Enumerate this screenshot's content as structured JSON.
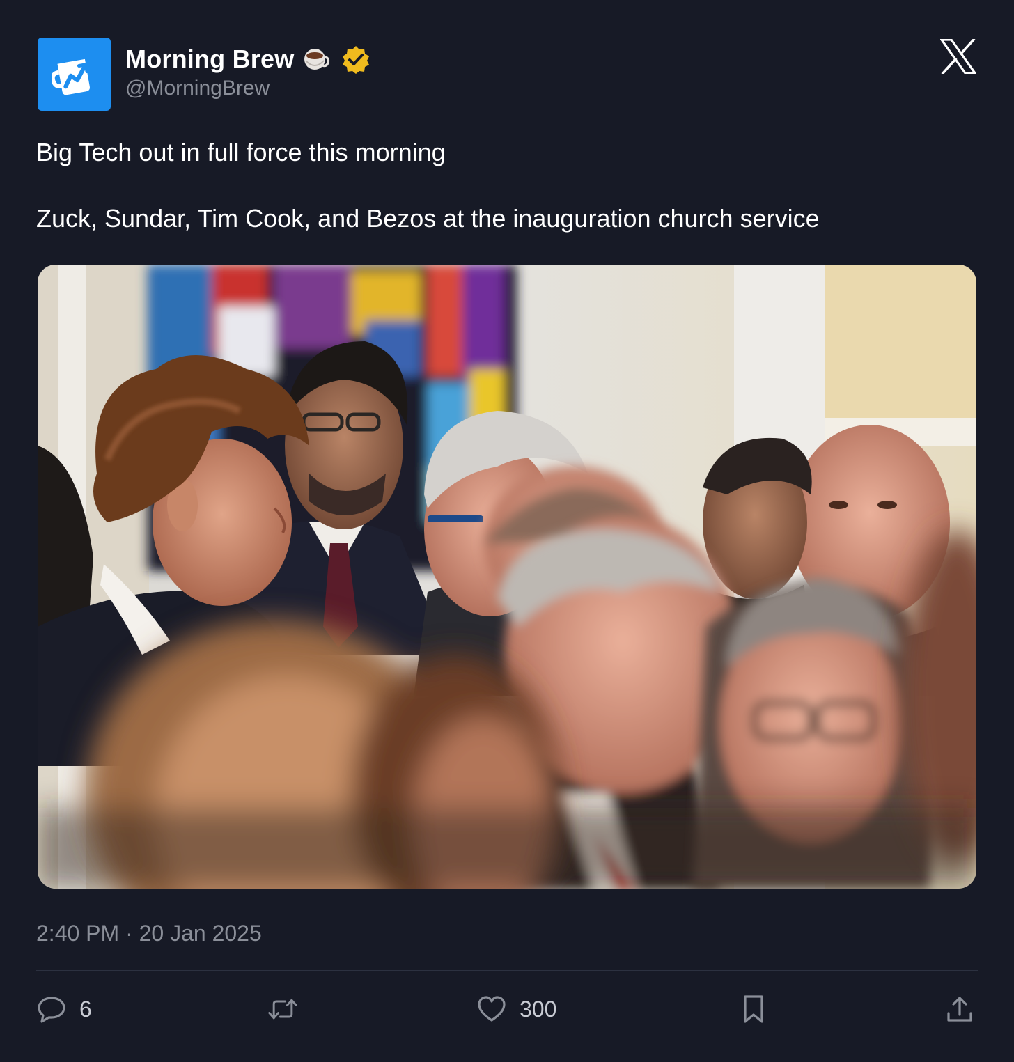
{
  "author": {
    "display_name": "Morning Brew",
    "handle": "@MorningBrew",
    "emoji": "coffee-cup",
    "verified": true,
    "avatar_color": "#1d8ef0",
    "badge_color": "#f0bb1e"
  },
  "platform_logo": "x-logo",
  "tweet": {
    "text_line1": "Big Tech out in full force this morning",
    "text_line2": "Zuck, Sundar, Tim Cook, and Bezos at the inauguration church service"
  },
  "media": {
    "type": "photo"
  },
  "meta": {
    "timestamp": "2:40 PM · 20 Jan 2025"
  },
  "actions": {
    "reply_count": "6",
    "retweet_count": "",
    "like_count": "300",
    "bookmark_count": "",
    "share_count": ""
  },
  "colors": {
    "background": "#171a26",
    "text_primary": "#ffffff",
    "text_secondary": "#8b8f99",
    "divider": "#2c3140"
  }
}
